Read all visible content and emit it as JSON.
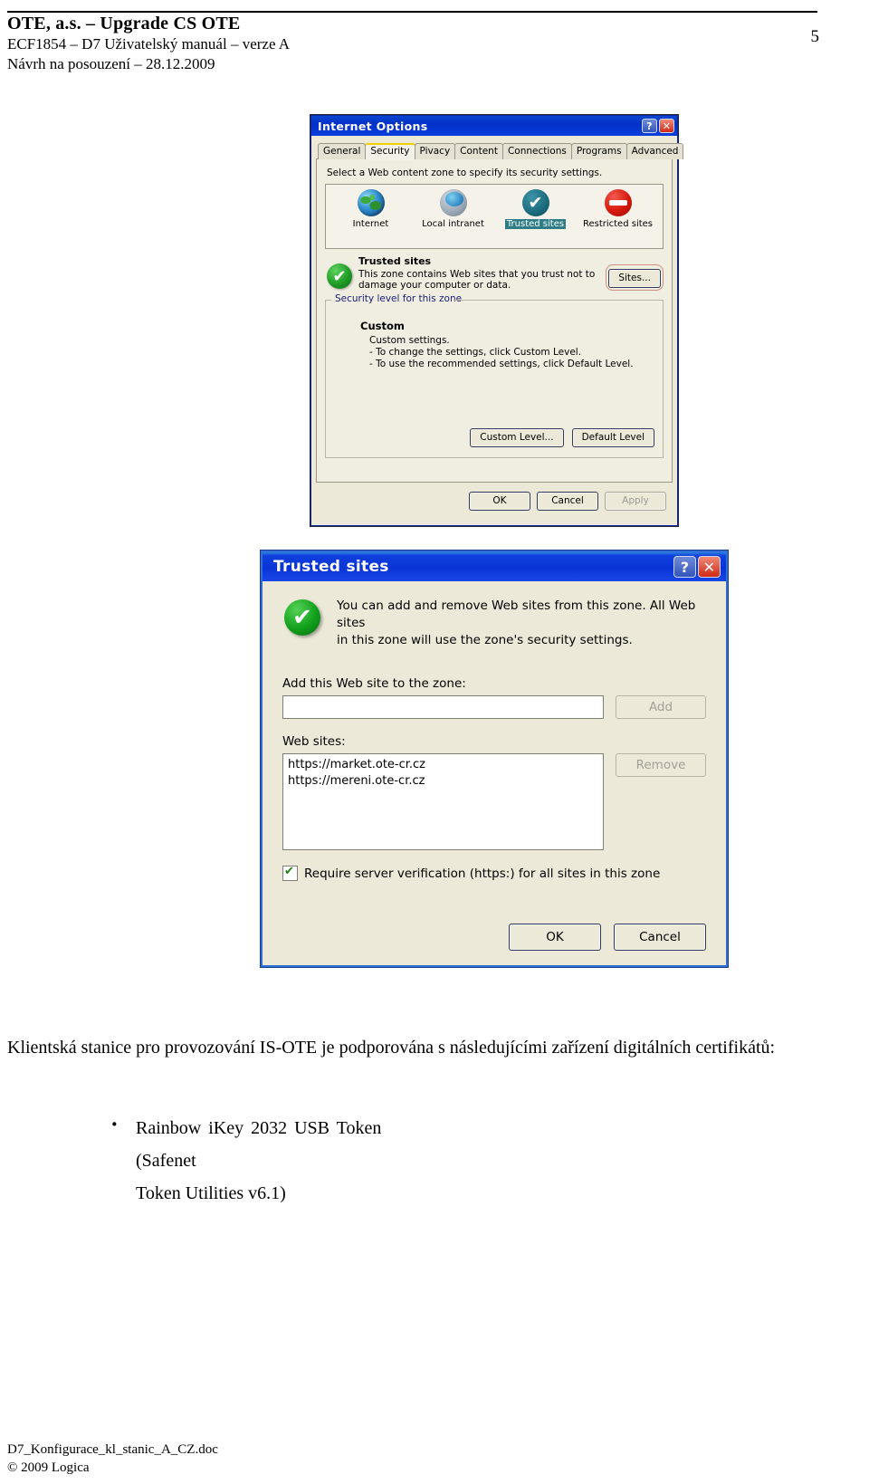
{
  "header": {
    "line1": "OTE, a.s. – Upgrade CS OTE",
    "line2": "ECF1854 – D7 Uživatelský manuál – verze A",
    "line3": "Návrh na posouzení – 28.12.2009",
    "page_number": "5"
  },
  "internet_options": {
    "title": "Internet Options",
    "help_glyph": "?",
    "close_glyph": "✕",
    "tabs": [
      {
        "label": "General",
        "active": false
      },
      {
        "label": "Security",
        "active": true
      },
      {
        "label": "Pivacy",
        "active": false
      },
      {
        "label": "Content",
        "active": false
      },
      {
        "label": "Connections",
        "active": false
      },
      {
        "label": "Programs",
        "active": false
      },
      {
        "label": "Advanced",
        "active": false
      }
    ],
    "zone_instruction": "Select a Web content zone to specify its security settings.",
    "zones": [
      {
        "label": "Internet",
        "selected": false
      },
      {
        "label": "Local intranet",
        "selected": false
      },
      {
        "label": "Trusted sites",
        "selected": true
      },
      {
        "label": "Restricted sites",
        "selected": false
      }
    ],
    "zone_detail": {
      "title": "Trusted sites",
      "description": "This zone contains Web sites that you trust not to damage your computer or data.",
      "sites_button": "Sites..."
    },
    "security_level": {
      "legend": "Security level for this zone",
      "level_name": "Custom",
      "line1": "Custom settings.",
      "line2": "- To change the settings, click Custom Level.",
      "line3": "- To use the recommended settings, click Default Level.",
      "custom_level_button": "Custom Level...",
      "default_level_button": "Default Level"
    },
    "footer": {
      "ok": "OK",
      "cancel": "Cancel",
      "apply": "Apply"
    }
  },
  "trusted_sites": {
    "title": "Trusted sites",
    "help_glyph": "?",
    "close_glyph": "✕",
    "intro_line1": "You can add and remove Web sites from this zone. All Web sites",
    "intro_line2": "in this zone will use the zone's security settings.",
    "add_label": "Add this Web site to the zone:",
    "add_input_value": "",
    "add_input_placeholder": "",
    "add_button": "Add",
    "websites_label": "Web sites:",
    "websites": [
      "https://market.ote-cr.cz",
      "https://mereni.ote-cr.cz"
    ],
    "remove_button": "Remove",
    "require_https_label": "Require server verification (https:) for all sites in this zone",
    "require_https_checked": true,
    "ok_button": "OK",
    "cancel_button": "Cancel"
  },
  "body": {
    "paragraph": "Klientská stanice pro provozování IS-OTE je podporována s následujícími zařízení digitálních certifikátů:",
    "bullets": [
      {
        "line1": "Rainbow  iKey  2032  USB  Token  (Safenet",
        "line2": "Token Utilities v6.1)"
      }
    ]
  },
  "footer": {
    "filename": "D7_Konfigurace_kl_stanic_A_CZ.doc",
    "copyright": "© 2009 Logica"
  },
  "colors": {
    "titlebar_blue": "#0a34d6",
    "dialog_face": "#ece9d8",
    "trusted_green": "#11a01b",
    "restricted_red": "#d6190c",
    "tab_highlight": "#f2d000",
    "selection_teal": "#2d7c86"
  }
}
